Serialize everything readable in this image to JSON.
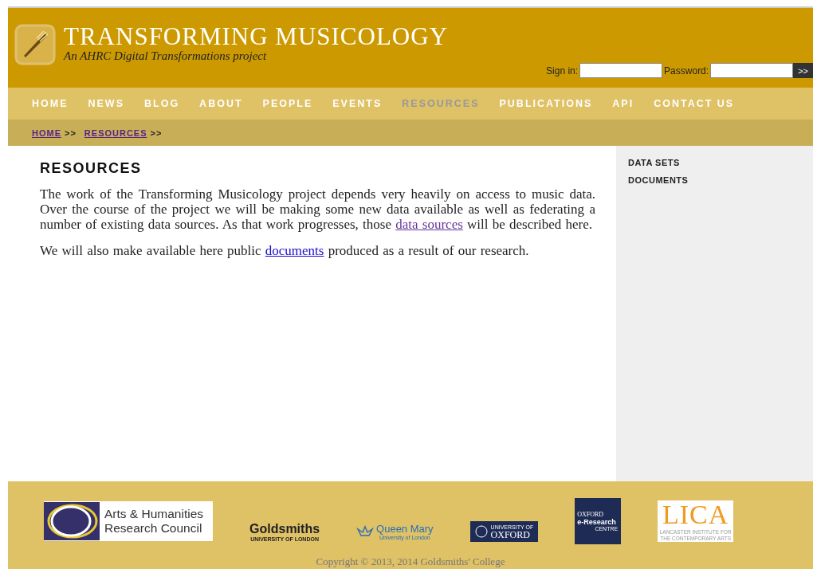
{
  "header": {
    "title": "TRANSFORMING MUSICOLOGY",
    "subtitle": "An AHRC Digital Transformations project",
    "sign_in_label": "Sign in:",
    "password_label": "Password:",
    "submit": ">>"
  },
  "nav": [
    {
      "label": "HOME",
      "selected": false
    },
    {
      "label": "NEWS",
      "selected": false
    },
    {
      "label": "BLOG",
      "selected": false
    },
    {
      "label": "ABOUT",
      "selected": false
    },
    {
      "label": "PEOPLE",
      "selected": false
    },
    {
      "label": "EVENTS",
      "selected": false
    },
    {
      "label": "RESOURCES",
      "selected": true
    },
    {
      "label": "PUBLICATIONS",
      "selected": false
    },
    {
      "label": "API",
      "selected": false
    },
    {
      "label": "CONTACT US",
      "selected": false
    }
  ],
  "breadcrumb": [
    {
      "label": "HOME",
      "separator": ">>"
    },
    {
      "label": "RESOURCES",
      "separator": ">>"
    }
  ],
  "main": {
    "heading": "RESOURCES",
    "paragraphs": [
      [
        {
          "text": "The work of the Transforming Musicology project depends very heavily on access to music data. Over the course of the project we will be making some new data available as well as federating a number of existing data sources. As that work progresses, those "
        },
        {
          "link": "data sources",
          "visited": true
        },
        {
          "text": " will be described here."
        }
      ],
      [
        {
          "text": "We will also make available here public "
        },
        {
          "link": "documents",
          "visited": false
        },
        {
          "text": " produced as a result of our research."
        }
      ]
    ]
  },
  "sidebar": {
    "items": [
      "DATA SETS",
      "DOCUMENTS"
    ]
  },
  "footer": {
    "logos": [
      {
        "kind": "ahrc",
        "lines": [
          "Arts & Humanities",
          "Research Council"
        ]
      },
      {
        "kind": "goldsmiths",
        "lines": [
          "Goldsmiths",
          "UNIVERSITY OF LONDON"
        ]
      },
      {
        "kind": "qmul",
        "lines": [
          "Queen Mary",
          "University of London"
        ]
      },
      {
        "kind": "oxford",
        "lines": [
          "UNIVERSITY OF",
          "OXFORD"
        ]
      },
      {
        "kind": "oerc",
        "lines": [
          "OXFORD",
          "e-Research",
          "CENTRE"
        ]
      },
      {
        "kind": "lica",
        "lines": [
          "LICA",
          "LANCASTER INSTITUTE FOR",
          "THE CONTEMPORARY ARTS"
        ]
      }
    ],
    "copyright": "Copyright © 2013, 2014 Goldsmiths' College"
  }
}
